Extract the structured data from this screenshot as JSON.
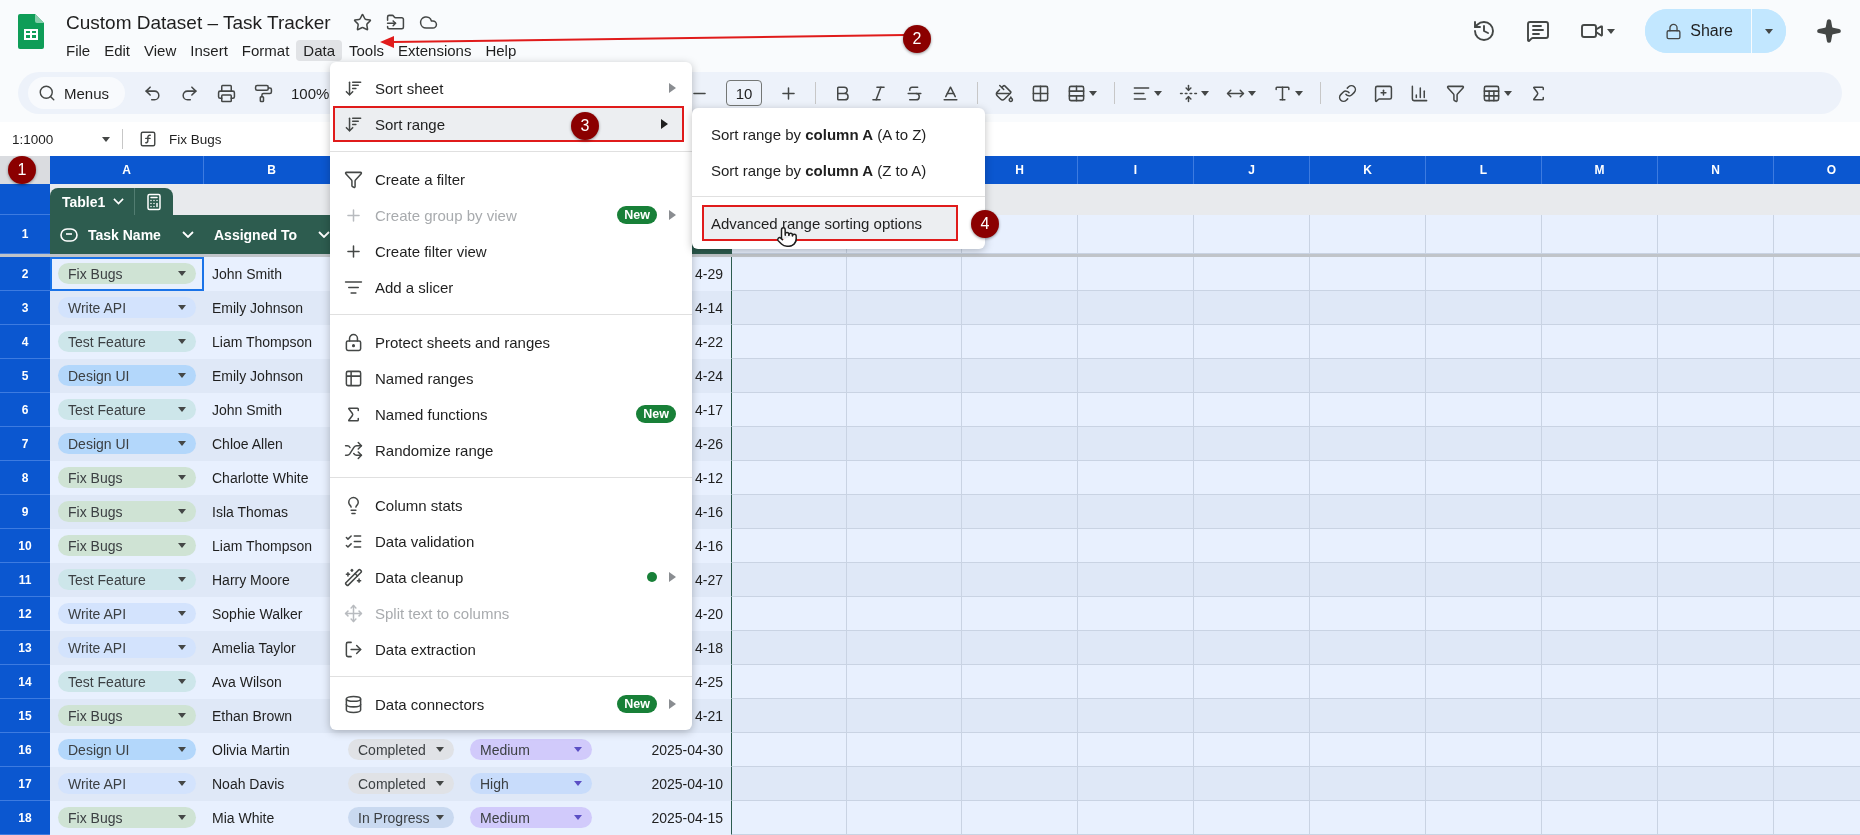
{
  "document": {
    "title": "Custom Dataset – Task Tracker"
  },
  "menu_bar": [
    {
      "label": "File",
      "selected": false
    },
    {
      "label": "Edit",
      "selected": false
    },
    {
      "label": "View",
      "selected": false
    },
    {
      "label": "Insert",
      "selected": false
    },
    {
      "label": "Format",
      "selected": false
    },
    {
      "label": "Data",
      "selected": true
    },
    {
      "label": "Tools",
      "selected": false
    },
    {
      "label": "Extensions",
      "selected": false
    },
    {
      "label": "Help",
      "selected": false
    }
  ],
  "share_button": {
    "label": "Share"
  },
  "toolbar": {
    "search_label": "Menus",
    "zoom": "100%",
    "font_size": "10"
  },
  "formula_bar": {
    "name_box": "1:1000",
    "value": "Fix Bugs"
  },
  "column_letters": [
    "A",
    "B",
    "H",
    "I",
    "J",
    "K",
    "L",
    "M",
    "N",
    "O"
  ],
  "table": {
    "name": "Table1",
    "header_row": "1",
    "headers": [
      "Task Name",
      "Assigned To"
    ],
    "rows": [
      {
        "row": "2",
        "task": {
          "label": "Fix Bugs",
          "color": "#cfe3d4"
        },
        "assignee": "John Smith",
        "date": "4-29",
        "selected": true
      },
      {
        "row": "3",
        "task": {
          "label": "Write API",
          "color": "#d3e3fd"
        },
        "assignee": "Emily Johnson",
        "date": "4-14",
        "selected": false
      },
      {
        "row": "4",
        "task": {
          "label": "Test Feature",
          "color": "#cde6ea"
        },
        "assignee": "Liam Thompson",
        "date": "4-22",
        "selected": false
      },
      {
        "row": "5",
        "task": {
          "label": "Design UI",
          "color": "#b3d7fb"
        },
        "assignee": "Emily Johnson",
        "date": "4-24",
        "selected": false
      },
      {
        "row": "6",
        "task": {
          "label": "Test Feature",
          "color": "#cde6ea"
        },
        "assignee": "John Smith",
        "date": "4-17",
        "selected": false
      },
      {
        "row": "7",
        "task": {
          "label": "Design UI",
          "color": "#b3d7fb"
        },
        "assignee": "Chloe Allen",
        "date": "4-26",
        "selected": false
      },
      {
        "row": "8",
        "task": {
          "label": "Fix Bugs",
          "color": "#cfe3d4"
        },
        "assignee": "Charlotte White",
        "date": "4-12",
        "selected": false
      },
      {
        "row": "9",
        "task": {
          "label": "Fix Bugs",
          "color": "#cfe3d4"
        },
        "assignee": "Isla Thomas",
        "date": "4-16",
        "selected": false
      },
      {
        "row": "10",
        "task": {
          "label": "Fix Bugs",
          "color": "#cfe3d4"
        },
        "assignee": "Liam Thompson",
        "date": "4-16",
        "selected": false
      },
      {
        "row": "11",
        "task": {
          "label": "Test Feature",
          "color": "#cde6ea"
        },
        "assignee": "Harry Moore",
        "date": "4-27",
        "selected": false
      },
      {
        "row": "12",
        "task": {
          "label": "Write API",
          "color": "#d3e3fd"
        },
        "assignee": "Sophie Walker",
        "date": "4-20",
        "selected": false
      },
      {
        "row": "13",
        "task": {
          "label": "Write API",
          "color": "#d3e3fd"
        },
        "assignee": "Amelia Taylor",
        "date": "4-18",
        "selected": false
      },
      {
        "row": "14",
        "task": {
          "label": "Test Feature",
          "color": "#cde6ea"
        },
        "assignee": "Ava Wilson",
        "date": "4-25",
        "selected": false
      },
      {
        "row": "15",
        "task": {
          "label": "Fix Bugs",
          "color": "#cfe3d4"
        },
        "assignee": "Ethan Brown",
        "date": "4-21",
        "selected": false
      },
      {
        "row": "16",
        "task": {
          "label": "Design UI",
          "color": "#b3d7fb"
        },
        "assignee": "Olivia Martin",
        "status": {
          "label": "Completed",
          "color": "#e0e2e6"
        },
        "priority": {
          "label": "Medium",
          "color": "#d1cafb"
        },
        "date": "2025-04-30",
        "selected": false
      },
      {
        "row": "17",
        "task": {
          "label": "Write API",
          "color": "#d3e3fd"
        },
        "assignee": "Noah Davis",
        "status": {
          "label": "Completed",
          "color": "#e0e2e6"
        },
        "priority": {
          "label": "High",
          "color": "#c8dcfb"
        },
        "date": "2025-04-10",
        "selected": false
      },
      {
        "row": "18",
        "task": {
          "label": "Fix Bugs",
          "color": "#cfe3d4"
        },
        "assignee": "Mia White",
        "status": {
          "label": "In Progress",
          "color": "#c9d9f0"
        },
        "priority": {
          "label": "Medium",
          "color": "#d1cafb"
        },
        "date": "2025-04-15",
        "selected": false
      }
    ]
  },
  "data_menu": {
    "sections": [
      {
        "items": [
          {
            "label": "Sort sheet",
            "submenu": true,
            "selected": false,
            "disabled": false,
            "dot": false
          },
          {
            "label": "Sort range",
            "submenu": true,
            "selected": true,
            "disabled": false,
            "dot": false
          }
        ]
      },
      {
        "items": [
          {
            "label": "Create a filter",
            "submenu": false,
            "selected": false,
            "disabled": false,
            "dot": false
          },
          {
            "label": "Create group by view",
            "badge": "New",
            "submenu": true,
            "selected": false,
            "disabled": true,
            "dot": false
          },
          {
            "label": "Create filter view",
            "submenu": false,
            "selected": false,
            "disabled": false,
            "dot": false
          },
          {
            "label": "Add a slicer",
            "submenu": false,
            "selected": false,
            "disabled": false,
            "dot": false
          }
        ]
      },
      {
        "items": [
          {
            "label": "Protect sheets and ranges",
            "submenu": false,
            "selected": false,
            "disabled": false,
            "dot": false
          },
          {
            "label": "Named ranges",
            "submenu": false,
            "selected": false,
            "disabled": false,
            "dot": false
          },
          {
            "label": "Named functions",
            "badge": "New",
            "submenu": false,
            "selected": false,
            "disabled": false,
            "dot": false
          },
          {
            "label": "Randomize range",
            "submenu": false,
            "selected": false,
            "disabled": false,
            "dot": false
          }
        ]
      },
      {
        "items": [
          {
            "label": "Column stats",
            "submenu": false,
            "selected": false,
            "disabled": false,
            "dot": false
          },
          {
            "label": "Data validation",
            "submenu": false,
            "selected": false,
            "disabled": false,
            "dot": false
          },
          {
            "label": "Data cleanup",
            "submenu": true,
            "selected": false,
            "disabled": false,
            "dot": true
          },
          {
            "label": "Split text to columns",
            "submenu": false,
            "selected": false,
            "disabled": true,
            "dot": false
          },
          {
            "label": "Data extraction",
            "submenu": false,
            "selected": false,
            "disabled": false,
            "dot": false
          }
        ]
      },
      {
        "items": [
          {
            "label": "Data connectors",
            "badge": "New",
            "submenu": true,
            "selected": false,
            "disabled": false,
            "dot": false
          }
        ]
      }
    ]
  },
  "sort_range_submenu": {
    "sections": [
      {
        "items": [
          {
            "text": "Sort range by **column A** (A to Z)",
            "selected": false
          },
          {
            "text": "Sort range by **column A** (Z to A)",
            "selected": false
          }
        ]
      },
      {
        "items": [
          {
            "text": "Advanced range sorting options",
            "selected": true
          }
        ]
      }
    ]
  },
  "callouts": [
    "1",
    "2",
    "3",
    "4"
  ]
}
